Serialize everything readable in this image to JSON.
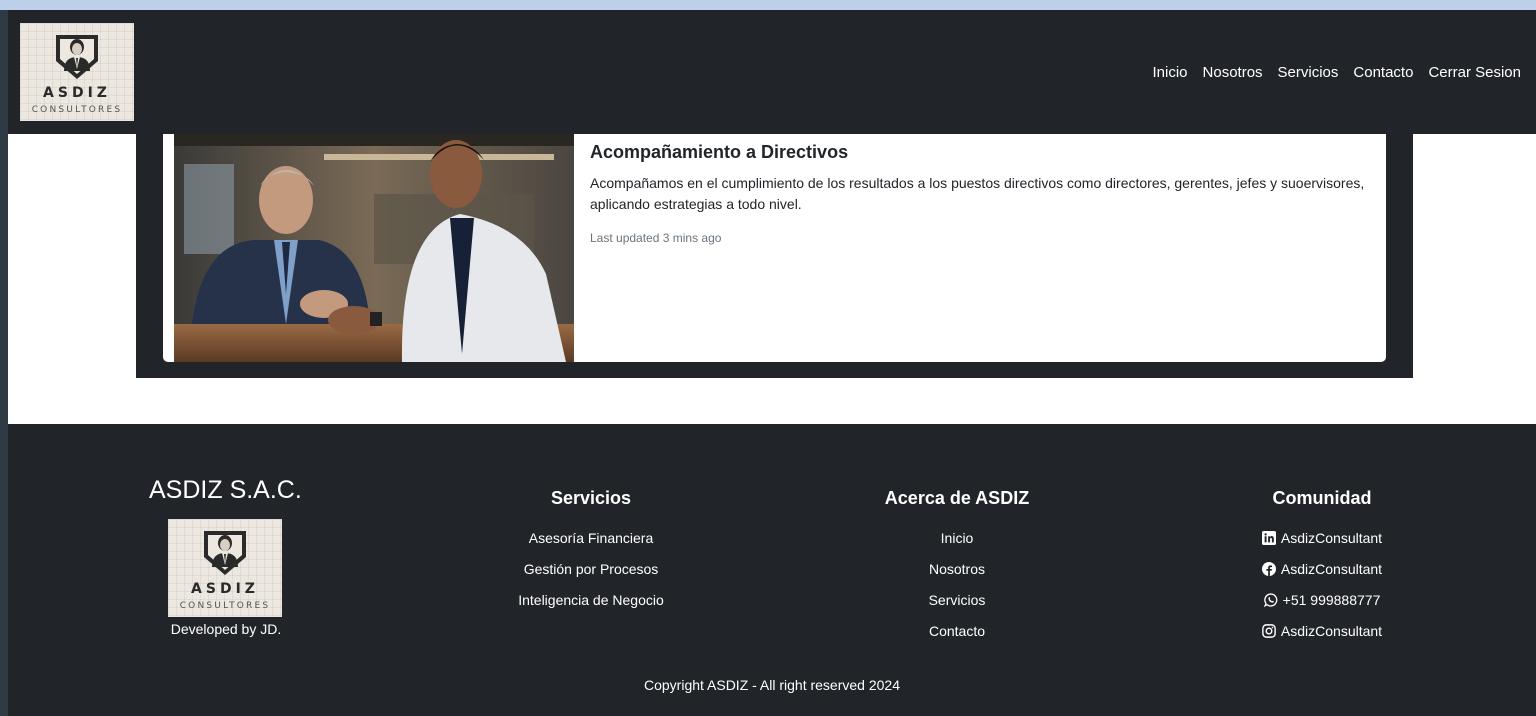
{
  "brand": {
    "logo_main": "ASDIZ",
    "logo_sub": "CONSULTORES"
  },
  "nav": {
    "items": [
      "Inicio",
      "Nosotros",
      "Servicios",
      "Contacto",
      "Cerrar Sesion"
    ]
  },
  "card": {
    "image_alt": "two-businessmen-meeting-photo",
    "title": "Acompañamiento a Directivos",
    "text": "Acompañamos en el cumplimiento de los resultados a los puestos directivos como directores, gerentes, jefes y suoervisores, aplicando estrategias a todo nivel.",
    "updated": "Last updated 3 mins ago"
  },
  "footer": {
    "company": "ASDIZ S.A.C.",
    "developed_by": "Developed by JD.",
    "services": {
      "title": "Servicios",
      "items": [
        "Asesoría Financiera",
        "Gestión por Procesos",
        "Inteligencia de Negocio"
      ]
    },
    "about": {
      "title": "Acerca de ASDIZ",
      "items": [
        "Inicio",
        "Nosotros",
        "Servicios",
        "Contacto"
      ]
    },
    "community": {
      "title": "Comunidad",
      "items": [
        {
          "icon": "linkedin-icon",
          "label": "AsdizConsultant"
        },
        {
          "icon": "facebook-icon",
          "label": "AsdizConsultant"
        },
        {
          "icon": "whatsapp-icon",
          "label": "+51 999888777"
        },
        {
          "icon": "instagram-icon",
          "label": "AsdizConsultant"
        }
      ]
    },
    "copyright": "Copyright ASDIZ - All right reserved 2024"
  },
  "colors": {
    "navbar_bg": "#212529",
    "page_bg": "#ffffff",
    "top_strip": "#bcd0ec",
    "muted_text": "#6c757d"
  }
}
